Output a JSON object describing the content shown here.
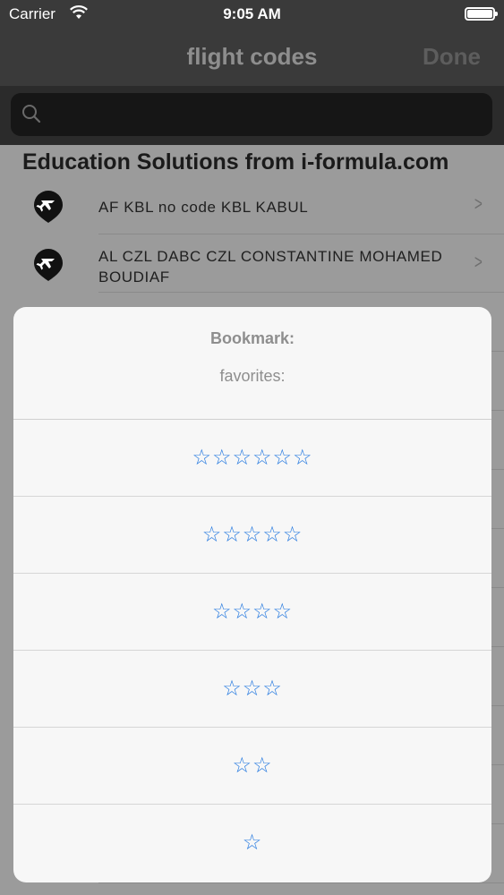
{
  "status_bar": {
    "carrier": "Carrier",
    "time": "9:05 AM"
  },
  "navbar": {
    "title": "flight codes",
    "done_label": "Done"
  },
  "search": {
    "placeholder": ""
  },
  "list": {
    "section_header": "Education Solutions from i-formula.com",
    "rows": [
      {
        "text": "AF  KBL  no code  KBL  KABUL",
        "icon": "airplane-pin-icon"
      },
      {
        "text": "AL  CZL  DABC  CZL  CONSTANTINE MOHAMED BOUDIAF",
        "icon": "airplane-pin-icon"
      }
    ]
  },
  "action_sheet": {
    "title": "Bookmark:",
    "subtitle": "favorites:",
    "options": [
      "☆☆☆☆☆☆",
      "☆☆☆☆☆",
      "☆☆☆☆",
      "☆☆☆",
      "☆☆",
      "☆"
    ]
  },
  "colors": {
    "accent": "#2a7ce0",
    "bar": "#3a3a3a"
  }
}
